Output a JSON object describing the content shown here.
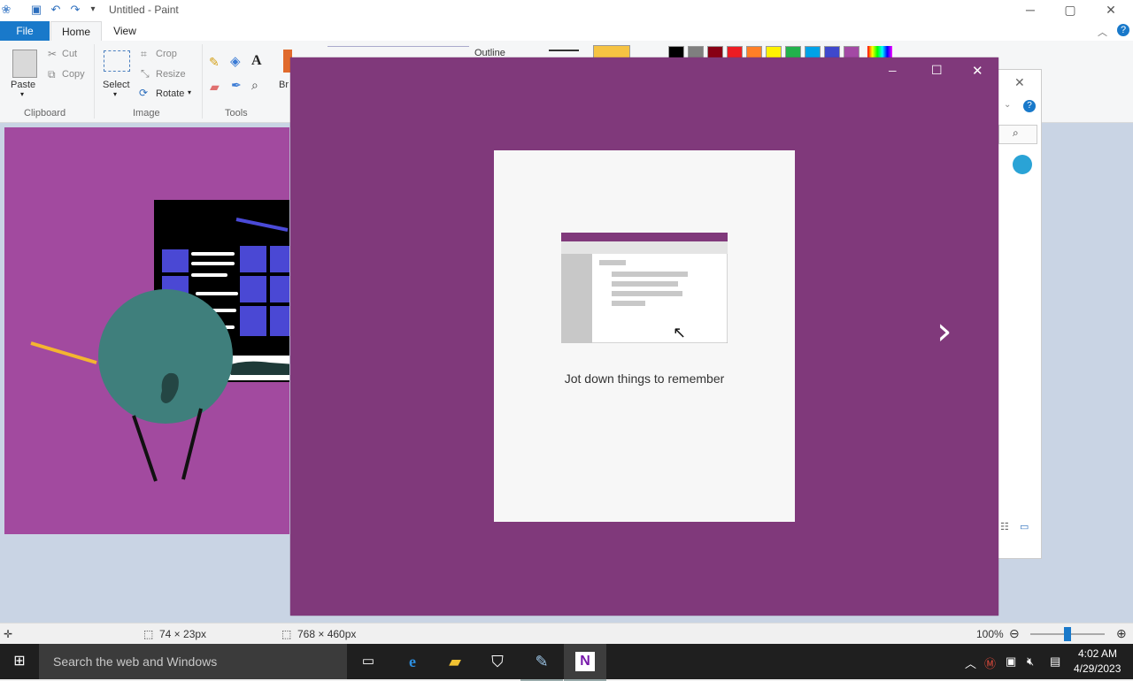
{
  "titlebar": {
    "title": "Untitled - Paint",
    "minimize": "─",
    "maximize": "▢",
    "close": "✕"
  },
  "tabs": {
    "file": "File",
    "home": "Home",
    "view": "View"
  },
  "ribbon": {
    "paste": "Paste",
    "cut": "Cut",
    "copy": "Copy",
    "clipboard_group": "Clipboard",
    "select": "Select",
    "crop": "Crop",
    "resize": "Resize",
    "rotate": "Rotate",
    "image_group": "Image",
    "tools_group": "Tools",
    "brushes_partial": "Br",
    "outline": "Outline",
    "palette": [
      "#000000",
      "#7f7f7f",
      "#880015",
      "#ed1c24",
      "#ff7f27",
      "#fff200",
      "#22b14c",
      "#00a2e8",
      "#3f48cc",
      "#a349a4"
    ]
  },
  "dialog": {
    "caption": "Jot down things to remember",
    "next": "›",
    "minimize": "─",
    "maximize": "☐",
    "close": "✕"
  },
  "status": {
    "selection_size": "74 × 23px",
    "canvas_size": "768 × 460px",
    "zoom": "100%"
  },
  "taskbar": {
    "search_placeholder": "Search the web and Windows",
    "time": "4:02 AM",
    "date": "4/29/2023"
  }
}
